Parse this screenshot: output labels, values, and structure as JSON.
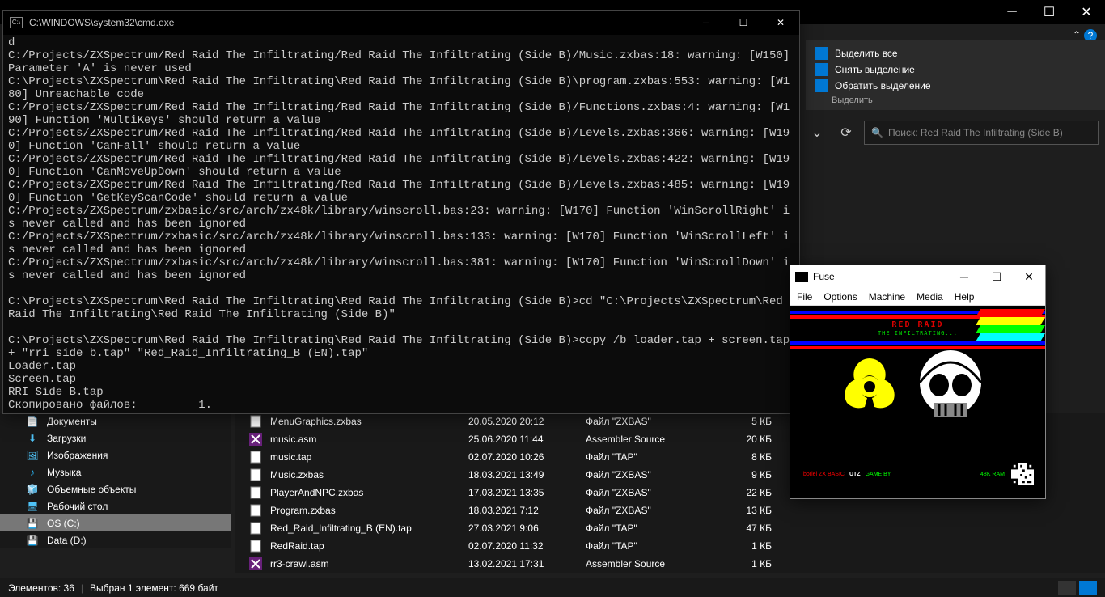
{
  "explorer": {
    "ribbon": {
      "select_all": "Выделить все",
      "select_none": "Снять выделение",
      "invert": "Обратить выделение",
      "group_label": "Выделить"
    },
    "search": {
      "placeholder": "Поиск: Red Raid The Infiltrating (Side B)"
    },
    "sidebar": {
      "items": [
        {
          "label": "Документы",
          "icon": "📄",
          "color": "#4fc3f7"
        },
        {
          "label": "Загрузки",
          "icon": "⬇",
          "color": "#4fc3f7"
        },
        {
          "label": "Изображения",
          "icon": "🖼",
          "color": "#4fc3f7"
        },
        {
          "label": "Музыка",
          "icon": "♪",
          "color": "#29b6f6"
        },
        {
          "label": "Объемные объекты",
          "icon": "🧊",
          "color": "#4fc3f7"
        },
        {
          "label": "Рабочий стол",
          "icon": "🖥",
          "color": "#4fc3f7"
        },
        {
          "label": "OS (C:)",
          "icon": "💾",
          "color": "#bdbdbd",
          "selected": true
        },
        {
          "label": "Data (D:)",
          "icon": "💾",
          "color": "#bdbdbd"
        }
      ]
    },
    "files": [
      {
        "name": "MenuGraphics.zxbas",
        "date": "20.05.2020 20:12",
        "type": "Файл \"ZXBAS\"",
        "size": "5 КБ",
        "icon": "file"
      },
      {
        "name": "music.asm",
        "date": "25.06.2020 11:44",
        "type": "Assembler Source",
        "size": "20 КБ",
        "icon": "vs"
      },
      {
        "name": "music.tap",
        "date": "02.07.2020 10:26",
        "type": "Файл \"TAP\"",
        "size": "8 КБ",
        "icon": "file"
      },
      {
        "name": "Music.zxbas",
        "date": "18.03.2021 13:49",
        "type": "Файл \"ZXBAS\"",
        "size": "9 КБ",
        "icon": "file"
      },
      {
        "name": "PlayerAndNPC.zxbas",
        "date": "17.03.2021 13:35",
        "type": "Файл \"ZXBAS\"",
        "size": "22 КБ",
        "icon": "file"
      },
      {
        "name": "Program.zxbas",
        "date": "18.03.2021 7:12",
        "type": "Файл \"ZXBAS\"",
        "size": "13 КБ",
        "icon": "file"
      },
      {
        "name": "Red_Raid_Infiltrating_B (EN).tap",
        "date": "27.03.2021 9:06",
        "type": "Файл \"TAP\"",
        "size": "47 КБ",
        "icon": "file"
      },
      {
        "name": "RedRaid.tap",
        "date": "02.07.2020 11:32",
        "type": "Файл \"TAP\"",
        "size": "1 КБ",
        "icon": "file"
      },
      {
        "name": "rr3-crawl.asm",
        "date": "13.02.2021 17:31",
        "type": "Assembler Source",
        "size": "1 КБ",
        "icon": "vs"
      }
    ],
    "status": {
      "count": "Элементов: 36",
      "selection": "Выбран 1 элемент: 669 байт"
    }
  },
  "cmd": {
    "title": "C:\\WINDOWS\\system32\\cmd.exe",
    "lines": [
      "d",
      "C:/Projects/ZXSpectrum/Red Raid The Infiltrating/Red Raid The Infiltrating (Side B)/Music.zxbas:18: warning: [W150] Parameter 'A' is never used",
      "C:\\Projects\\ZXSpectrum\\Red Raid The Infiltrating\\Red Raid The Infiltrating (Side B)\\program.zxbas:553: warning: [W180] Unreachable code",
      "C:/Projects/ZXSpectrum/Red Raid The Infiltrating/Red Raid The Infiltrating (Side B)/Functions.zxbas:4: warning: [W190] Function 'MultiKeys' should return a value",
      "C:/Projects/ZXSpectrum/Red Raid The Infiltrating/Red Raid The Infiltrating (Side B)/Levels.zxbas:366: warning: [W190] Function 'CanFall' should return a value",
      "C:/Projects/ZXSpectrum/Red Raid The Infiltrating/Red Raid The Infiltrating (Side B)/Levels.zxbas:422: warning: [W190] Function 'CanMoveUpDown' should return a value",
      "C:/Projects/ZXSpectrum/Red Raid The Infiltrating/Red Raid The Infiltrating (Side B)/Levels.zxbas:485: warning: [W190] Function 'GetKeyScanCode' should return a value",
      "C:/Projects/ZXSpectrum/zxbasic/src/arch/zx48k/library/winscroll.bas:23: warning: [W170] Function 'WinScrollRight' is never called and has been ignored",
      "C:/Projects/ZXSpectrum/zxbasic/src/arch/zx48k/library/winscroll.bas:133: warning: [W170] Function 'WinScrollLeft' is never called and has been ignored",
      "C:/Projects/ZXSpectrum/zxbasic/src/arch/zx48k/library/winscroll.bas:381: warning: [W170] Function 'WinScrollDown' is never called and has been ignored",
      "",
      "C:\\Projects\\ZXSpectrum\\Red Raid The Infiltrating\\Red Raid The Infiltrating (Side B)>cd \"C:\\Projects\\ZXSpectrum\\Red Raid The Infiltrating\\Red Raid The Infiltrating (Side B)\"",
      "",
      "C:\\Projects\\ZXSpectrum\\Red Raid The Infiltrating\\Red Raid The Infiltrating (Side B)>copy /b loader.tap + screen.tap + \"rri side b.tap\" \"Red_Raid_Infiltrating_B (EN).tap\"",
      "Loader.tap",
      "Screen.tap",
      "RRI Side B.tap",
      "Скопировано файлов:         1."
    ]
  },
  "fuse": {
    "title": "Fuse",
    "menu": [
      "File",
      "Options",
      "Machine",
      "Media",
      "Help"
    ],
    "game_title": "RED RAID",
    "game_subtitle": "THE INFILTRATING...",
    "footer_left": "boriel ZX BASIC",
    "footer_utz": "UTZ",
    "footer_mid": "GAME BY",
    "footer_right": "48K RAM"
  }
}
